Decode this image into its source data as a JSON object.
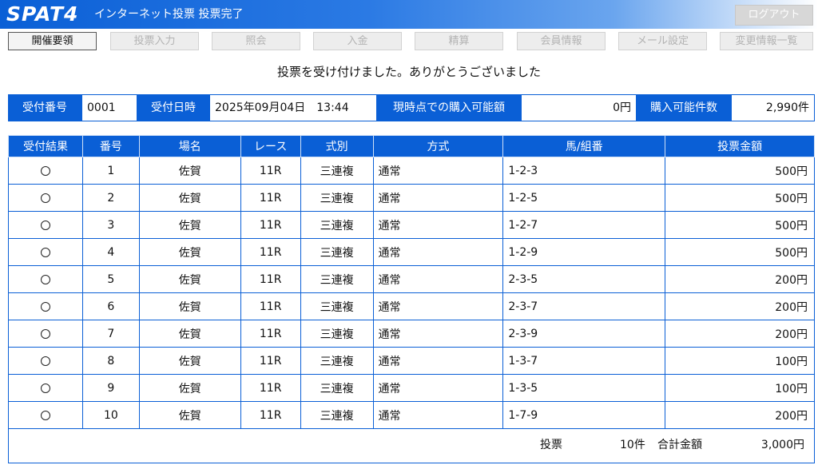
{
  "header": {
    "logo": "SPAT4",
    "title": "インターネット投票 投票完了",
    "logout_label": "ログアウト"
  },
  "nav": {
    "items": [
      {
        "label": "開催要領",
        "active": true
      },
      {
        "label": "投票入力",
        "active": false
      },
      {
        "label": "照会",
        "active": false
      },
      {
        "label": "入金",
        "active": false
      },
      {
        "label": "精算",
        "active": false
      },
      {
        "label": "会員情報",
        "active": false
      },
      {
        "label": "メール設定",
        "active": false
      },
      {
        "label": "変更情報一覧",
        "active": false
      }
    ]
  },
  "message": "投票を受け付けました。ありがとうございました",
  "info": {
    "receipt_no_label": "受付番号",
    "receipt_no": "0001",
    "receipt_time_label": "受付日時",
    "receipt_time": "2025年09月04日　13:44",
    "balance_label": "現時点での購入可能額",
    "balance": "0円",
    "count_label": "購入可能件数",
    "count": "2,990件"
  },
  "table": {
    "headers": [
      "受付結果",
      "番号",
      "場名",
      "レース",
      "式別",
      "方式",
      "馬/組番",
      "投票金額"
    ],
    "rows": [
      {
        "result": "○",
        "no": "1",
        "venue": "佐賀",
        "race": "11R",
        "type": "三連複",
        "method": "通常",
        "combo": "1-2-3",
        "amount": "500円"
      },
      {
        "result": "○",
        "no": "2",
        "venue": "佐賀",
        "race": "11R",
        "type": "三連複",
        "method": "通常",
        "combo": "1-2-5",
        "amount": "500円"
      },
      {
        "result": "○",
        "no": "3",
        "venue": "佐賀",
        "race": "11R",
        "type": "三連複",
        "method": "通常",
        "combo": "1-2-7",
        "amount": "500円"
      },
      {
        "result": "○",
        "no": "4",
        "venue": "佐賀",
        "race": "11R",
        "type": "三連複",
        "method": "通常",
        "combo": "1-2-9",
        "amount": "500円"
      },
      {
        "result": "○",
        "no": "5",
        "venue": "佐賀",
        "race": "11R",
        "type": "三連複",
        "method": "通常",
        "combo": "2-3-5",
        "amount": "200円"
      },
      {
        "result": "○",
        "no": "6",
        "venue": "佐賀",
        "race": "11R",
        "type": "三連複",
        "method": "通常",
        "combo": "2-3-7",
        "amount": "200円"
      },
      {
        "result": "○",
        "no": "7",
        "venue": "佐賀",
        "race": "11R",
        "type": "三連複",
        "method": "通常",
        "combo": "2-3-9",
        "amount": "200円"
      },
      {
        "result": "○",
        "no": "8",
        "venue": "佐賀",
        "race": "11R",
        "type": "三連複",
        "method": "通常",
        "combo": "1-3-7",
        "amount": "100円"
      },
      {
        "result": "○",
        "no": "9",
        "venue": "佐賀",
        "race": "11R",
        "type": "三連複",
        "method": "通常",
        "combo": "1-3-5",
        "amount": "100円"
      },
      {
        "result": "○",
        "no": "10",
        "venue": "佐賀",
        "race": "11R",
        "type": "三連複",
        "method": "通常",
        "combo": "1-7-9",
        "amount": "200円"
      }
    ]
  },
  "summary": {
    "vote_label": "投票",
    "vote_count": "10件",
    "total_label": "合計金額",
    "total_amount": "3,000円"
  },
  "colors": {
    "accent": "#0a5fd6",
    "header_gradient_end": "#ffffff"
  }
}
